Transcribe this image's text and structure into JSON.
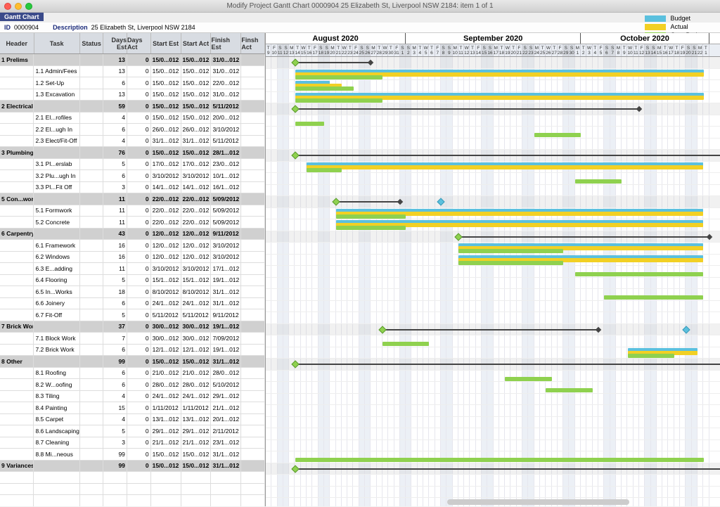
{
  "window": {
    "title": "Modify Project Gantt Chart 0000904 25 Elizabeth St, Liverpool NSW 2184: item 1  of  1",
    "tab": "Gantt Chart",
    "id_label": "ID",
    "id_value": "0000904",
    "desc_label": "Description",
    "desc_value": "25 Elizabeth St, Liverpool NSW 2184"
  },
  "legend": {
    "budget": {
      "label": "Budget",
      "color": "#5bc0de"
    },
    "actual": {
      "label": "Actual",
      "color": "#f2d024"
    },
    "over": {
      "label": "Over Budget",
      "color": "#8fd14f"
    }
  },
  "columns": [
    "Header",
    "Task",
    "Status",
    "Days Est",
    "Days Act",
    "Start Est",
    "Start Act",
    "Finish Est",
    "Finsh Act"
  ],
  "months": [
    {
      "label": "August 2020",
      "days": 24
    },
    {
      "label": "September 2020",
      "days": 30
    },
    {
      "label": "October 2020",
      "days": 22
    }
  ],
  "day_letters": [
    "T",
    "F",
    "S",
    "S",
    "M",
    "T",
    "W",
    "T",
    "F",
    "S",
    "S",
    "M",
    "T",
    "W",
    "T",
    "F",
    "S",
    "S",
    "M",
    "T",
    "W",
    "T",
    "F",
    "S",
    "S",
    "M",
    "T",
    "W",
    "T",
    "F",
    "S",
    "S",
    "M",
    "T",
    "W",
    "T",
    "F",
    "S",
    "S",
    "M",
    "T",
    "W",
    "T",
    "F",
    "S",
    "S",
    "M",
    "T",
    "W",
    "T",
    "F",
    "S",
    "S",
    "M",
    "T",
    "W",
    "T",
    "F",
    "S",
    "S",
    "M",
    "T",
    "W",
    "T",
    "F",
    "S",
    "S",
    "M",
    "T",
    "W",
    "T",
    "F",
    "S",
    "S",
    "M",
    "T"
  ],
  "day_numbers": [
    "9",
    "10",
    "11",
    "12",
    "13",
    "14",
    "15",
    "16",
    "17",
    "18",
    "19",
    "20",
    "21",
    "22",
    "23",
    "24",
    "25",
    "26",
    "27",
    "28",
    "29",
    "30",
    "31",
    "1",
    "2",
    "3",
    "4",
    "5",
    "6",
    "7",
    "8",
    "9",
    "10",
    "11",
    "12",
    "13",
    "14",
    "15",
    "16",
    "17",
    "18",
    "19",
    "20",
    "21",
    "22",
    "23",
    "24",
    "25",
    "26",
    "27",
    "28",
    "29",
    "30",
    "1",
    "2",
    "3",
    "4",
    "5",
    "6",
    "7",
    "8",
    "9",
    "10",
    "11",
    "12",
    "13",
    "14",
    "15",
    "16",
    "17",
    "18",
    "19",
    "20",
    "21",
    "22",
    "1"
  ],
  "rows": [
    {
      "summary": true,
      "header": "1 Prelims",
      "task": "",
      "de": "13",
      "da": "0",
      "se": "15/0...012",
      "sa": "15/0...012",
      "fe": "31/0...012",
      "fa": "",
      "bar": {
        "s": 5,
        "l": 13,
        "sum": true
      },
      "diamond": 5
    },
    {
      "header": "",
      "task": "1.1 Admin/Fees",
      "de": "13",
      "da": "0",
      "se": "15/0...012",
      "sa": "15/0...012",
      "fe": "31/0...012",
      "fa": "",
      "bars": [
        {
          "t": "budget",
          "s": 5,
          "l": 70
        },
        {
          "t": "actual",
          "s": 5,
          "l": 70
        },
        {
          "t": "over",
          "s": 5,
          "l": 15
        }
      ]
    },
    {
      "header": "",
      "task": "1.2 Set-Up",
      "de": "6",
      "da": "0",
      "se": "15/0...012",
      "sa": "15/0...012",
      "fe": "22/0...012",
      "fa": "",
      "bars": [
        {
          "t": "budget",
          "s": 5,
          "l": 6
        },
        {
          "t": "actual",
          "s": 5,
          "l": 8
        },
        {
          "t": "over",
          "s": 5,
          "l": 10
        }
      ]
    },
    {
      "header": "",
      "task": "1.3 Excavation",
      "de": "13",
      "da": "0",
      "se": "15/0...012",
      "sa": "15/0...012",
      "fe": "31/0...012",
      "fa": "",
      "bars": [
        {
          "t": "budget",
          "s": 5,
          "l": 70
        },
        {
          "t": "actual",
          "s": 5,
          "l": 70
        },
        {
          "t": "over",
          "s": 5,
          "l": 15
        }
      ]
    },
    {
      "summary": true,
      "header": "2 Electrical",
      "task": "",
      "de": "59",
      "da": "0",
      "se": "15/0...012",
      "sa": "15/0...012",
      "fe": "5/11/2012",
      "fa": "",
      "bar": {
        "s": 5,
        "l": 59,
        "sum": true
      },
      "diamond": 5
    },
    {
      "header": "",
      "task": "2.1 El...rofiles",
      "de": "4",
      "da": "0",
      "se": "15/0...012",
      "sa": "15/0...012",
      "fe": "20/0...012",
      "fa": "",
      "bars": [
        {
          "t": "over",
          "s": 5,
          "l": 5
        }
      ]
    },
    {
      "header": "",
      "task": "2.2 El...ugh In",
      "de": "6",
      "da": "0",
      "se": "26/0...012",
      "sa": "26/0...012",
      "fe": "3/10/2012",
      "fa": "",
      "bars": [
        {
          "t": "over",
          "s": 46,
          "l": 8
        }
      ]
    },
    {
      "header": "",
      "task": "2.3 Elect/Fit-Off",
      "de": "4",
      "da": "0",
      "se": "31/1...012",
      "sa": "31/1...012",
      "fe": "5/11/2012",
      "fa": ""
    },
    {
      "summary": true,
      "header": "3 Plumbing",
      "task": "",
      "de": "76",
      "da": "0",
      "se": "15/0...012",
      "sa": "15/0...012",
      "fe": "28/1...012",
      "fa": "",
      "bar": {
        "s": 5,
        "l": 76,
        "sum": true
      },
      "diamond": 5
    },
    {
      "header": "",
      "task": "3.1 Pl...erslab",
      "de": "5",
      "da": "0",
      "se": "17/0...012",
      "sa": "17/0...012",
      "fe": "23/0...012",
      "fa": "",
      "bars": [
        {
          "t": "budget",
          "s": 7,
          "l": 68
        },
        {
          "t": "actual",
          "s": 7,
          "l": 68
        },
        {
          "t": "over",
          "s": 7,
          "l": 6
        }
      ]
    },
    {
      "header": "",
      "task": "3.2 Plu...ugh In",
      "de": "6",
      "da": "0",
      "se": "3/10/2012",
      "sa": "3/10/2012",
      "fe": "10/1...012",
      "fa": "",
      "bars": [
        {
          "t": "over",
          "s": 53,
          "l": 8
        }
      ]
    },
    {
      "header": "",
      "task": "3.3 Pl...Fit Off",
      "de": "3",
      "da": "0",
      "se": "14/1...012",
      "sa": "14/1...012",
      "fe": "16/1...012",
      "fa": ""
    },
    {
      "summary": true,
      "header": "5 Con...work",
      "task": "",
      "de": "11",
      "da": "0",
      "se": "22/0...012",
      "sa": "22/0...012",
      "fe": "5/09/2012",
      "fa": "",
      "bar": {
        "s": 12,
        "l": 11,
        "sum": true
      },
      "diamond": 12,
      "blue_diamond": 30
    },
    {
      "header": "",
      "task": "5.1 Formwork",
      "de": "11",
      "da": "0",
      "se": "22/0...012",
      "sa": "22/0...012",
      "fe": "5/09/2012",
      "fa": "",
      "bars": [
        {
          "t": "budget",
          "s": 12,
          "l": 63
        },
        {
          "t": "actual",
          "s": 12,
          "l": 63
        },
        {
          "t": "over",
          "s": 12,
          "l": 12
        }
      ]
    },
    {
      "header": "",
      "task": "5.2 Concrete",
      "de": "11",
      "da": "0",
      "se": "22/0...012",
      "sa": "22/0...012",
      "fe": "5/09/2012",
      "fa": "",
      "bars": [
        {
          "t": "budget",
          "s": 12,
          "l": 63
        },
        {
          "t": "actual",
          "s": 12,
          "l": 63
        },
        {
          "t": "over",
          "s": 12,
          "l": 12
        }
      ]
    },
    {
      "summary": true,
      "header": "6 Carpentry",
      "task": "",
      "de": "43",
      "da": "0",
      "se": "12/0...012",
      "sa": "12/0...012",
      "fe": "9/11/2012",
      "fa": "",
      "bar": {
        "s": 33,
        "l": 43,
        "sum": true
      },
      "diamond": 33
    },
    {
      "header": "",
      "task": "6.1 Framework",
      "de": "16",
      "da": "0",
      "se": "12/0...012",
      "sa": "12/0...012",
      "fe": "3/10/2012",
      "fa": "",
      "bars": [
        {
          "t": "budget",
          "s": 33,
          "l": 42
        },
        {
          "t": "actual",
          "s": 33,
          "l": 42
        },
        {
          "t": "over",
          "s": 33,
          "l": 18
        }
      ]
    },
    {
      "header": "",
      "task": "6.2 Windows",
      "de": "16",
      "da": "0",
      "se": "12/0...012",
      "sa": "12/0...012",
      "fe": "3/10/2012",
      "fa": "",
      "bars": [
        {
          "t": "budget",
          "s": 33,
          "l": 42
        },
        {
          "t": "actual",
          "s": 33,
          "l": 42
        },
        {
          "t": "over",
          "s": 33,
          "l": 18
        }
      ]
    },
    {
      "header": "",
      "task": "6.3 E...adding",
      "de": "11",
      "da": "0",
      "se": "3/10/2012",
      "sa": "3/10/2012",
      "fe": "17/1...012",
      "fa": "",
      "bars": [
        {
          "t": "over",
          "s": 53,
          "l": 22
        }
      ]
    },
    {
      "header": "",
      "task": "6.4 Flooring",
      "de": "5",
      "da": "0",
      "se": "15/1...012",
      "sa": "15/1...012",
      "fe": "19/1...012",
      "fa": ""
    },
    {
      "header": "",
      "task": "6.5 In...Works",
      "de": "18",
      "da": "0",
      "se": "8/10/2012",
      "sa": "8/10/2012",
      "fe": "31/1...012",
      "fa": "",
      "bars": [
        {
          "t": "over",
          "s": 58,
          "l": 17
        }
      ]
    },
    {
      "header": "",
      "task": "6.6 Joinery",
      "de": "6",
      "da": "0",
      "se": "24/1...012",
      "sa": "24/1...012",
      "fe": "31/1...012",
      "fa": ""
    },
    {
      "header": "",
      "task": "6.7 Fit-Off",
      "de": "5",
      "da": "0",
      "se": "5/11/2012",
      "sa": "5/11/2012",
      "fe": "9/11/2012",
      "fa": ""
    },
    {
      "summary": true,
      "header": "7 Brick Work",
      "task": "",
      "de": "37",
      "da": "0",
      "se": "30/0...012",
      "sa": "30/0...012",
      "fe": "19/1...012",
      "fa": "",
      "bar": {
        "s": 20,
        "l": 37,
        "sum": true
      },
      "diamond": 20,
      "blue_diamond": 72
    },
    {
      "header": "",
      "task": "7.1 Block Work",
      "de": "7",
      "da": "0",
      "se": "30/0...012",
      "sa": "30/0...012",
      "fe": "7/09/2012",
      "fa": "",
      "bars": [
        {
          "t": "over",
          "s": 20,
          "l": 8
        }
      ]
    },
    {
      "header": "",
      "task": "7.2 Brick Work",
      "de": "6",
      "da": "0",
      "se": "12/1...012",
      "sa": "12/1...012",
      "fe": "19/1...012",
      "fa": "",
      "bars": [
        {
          "t": "budget",
          "s": 62,
          "l": 12
        },
        {
          "t": "actual",
          "s": 62,
          "l": 12
        },
        {
          "t": "over",
          "s": 62,
          "l": 8
        }
      ]
    },
    {
      "summary": true,
      "header": "8 Other",
      "task": "",
      "de": "99",
      "da": "0",
      "se": "15/0...012",
      "sa": "15/0...012",
      "fe": "31/1...012",
      "fa": "",
      "bar": {
        "s": 5,
        "l": 76,
        "sum": true
      },
      "diamond": 5
    },
    {
      "header": "",
      "task": "8.1 Roofing",
      "de": "6",
      "da": "0",
      "se": "21/0...012",
      "sa": "21/0...012",
      "fe": "28/0...012",
      "fa": "",
      "bars": [
        {
          "t": "over",
          "s": 41,
          "l": 8
        }
      ]
    },
    {
      "header": "",
      "task": "8.2 W...oofing",
      "de": "6",
      "da": "0",
      "se": "28/0...012",
      "sa": "28/0...012",
      "fe": "5/10/2012",
      "fa": "",
      "bars": [
        {
          "t": "over",
          "s": 48,
          "l": 8
        }
      ]
    },
    {
      "header": "",
      "task": "8.3 Tiling",
      "de": "4",
      "da": "0",
      "se": "24/1...012",
      "sa": "24/1...012",
      "fe": "29/1...012",
      "fa": ""
    },
    {
      "header": "",
      "task": "8.4 Painting",
      "de": "15",
      "da": "0",
      "se": "1/11/2012",
      "sa": "1/11/2012",
      "fe": "21/1...012",
      "fa": ""
    },
    {
      "header": "",
      "task": "8.5 Carpet",
      "de": "4",
      "da": "0",
      "se": "13/1...012",
      "sa": "13/1...012",
      "fe": "20/1...012",
      "fa": ""
    },
    {
      "header": "",
      "task": "8.6 Landscaping",
      "de": "5",
      "da": "0",
      "se": "29/1...012",
      "sa": "29/1...012",
      "fe": "2/11/2012",
      "fa": ""
    },
    {
      "header": "",
      "task": "8.7 Cleaning",
      "de": "3",
      "da": "0",
      "se": "21/1...012",
      "sa": "21/1...012",
      "fe": "23/1...012",
      "fa": ""
    },
    {
      "header": "",
      "task": "8.8 Mi...neous",
      "de": "99",
      "da": "0",
      "se": "15/0...012",
      "sa": "15/0...012",
      "fe": "31/1...012",
      "fa": "",
      "bars": [
        {
          "t": "over",
          "s": 5,
          "l": 70
        }
      ]
    },
    {
      "summary": true,
      "header": "9 Variances",
      "task": "",
      "de": "99",
      "da": "0",
      "se": "15/0...012",
      "sa": "15/0...012",
      "fe": "31/1...012",
      "fa": "",
      "bar": {
        "s": 5,
        "l": 76,
        "sum": true
      },
      "diamond": 5
    },
    {
      "empty": true
    },
    {
      "empty": true
    },
    {
      "empty": true
    }
  ]
}
